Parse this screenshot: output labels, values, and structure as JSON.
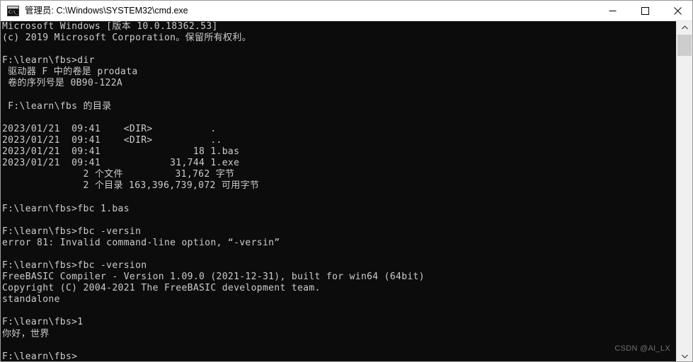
{
  "window": {
    "title": "管理员: C:\\Windows\\SYSTEM32\\cmd.exe",
    "icon_name": "cmd-icon",
    "icon_glyph": "C:\\_",
    "minimize_label": "—",
    "maximize_label": "□",
    "close_label": "✕",
    "titlebar_bg": "#ffffff",
    "titlebar_fg": "#000000"
  },
  "console": {
    "background": "#0c0c0c",
    "foreground": "#cccccc",
    "lines": [
      "Microsoft Windows [版本 10.0.18362.53]",
      "(c) 2019 Microsoft Corporation。保留所有权利。",
      "",
      "F:\\learn\\fbs>dir",
      " 驱动器 F 中的卷是 prodata",
      " 卷的序列号是 0B90-122A",
      "",
      " F:\\learn\\fbs 的目录",
      "",
      "2023/01/21  09:41    <DIR>          .",
      "2023/01/21  09:41    <DIR>          ..",
      "2023/01/21  09:41                18 1.bas",
      "2023/01/21  09:41            31,744 1.exe",
      "              2 个文件         31,762 字节",
      "              2 个目录 163,396,739,072 可用字节",
      "",
      "F:\\learn\\fbs>fbc 1.bas",
      "",
      "F:\\learn\\fbs>fbc -versin",
      "error 81: Invalid command-line option, “-versin”",
      "",
      "F:\\learn\\fbs>fbc -version",
      "FreeBASIC Compiler - Version 1.09.0 (2021-12-31), built for win64 (64bit)",
      "Copyright (C) 2004-2021 The FreeBASIC development team.",
      "standalone",
      "",
      "F:\\learn\\fbs>1",
      "你好，世界",
      "",
      "F:\\learn\\fbs>"
    ],
    "watermark": "CSDN @AI_LX"
  },
  "scrollbar": {
    "up_arrow": "⌃",
    "down_arrow": "⌄",
    "track_color": "#f0f0f0",
    "thumb_color": "#cdcdcd"
  }
}
